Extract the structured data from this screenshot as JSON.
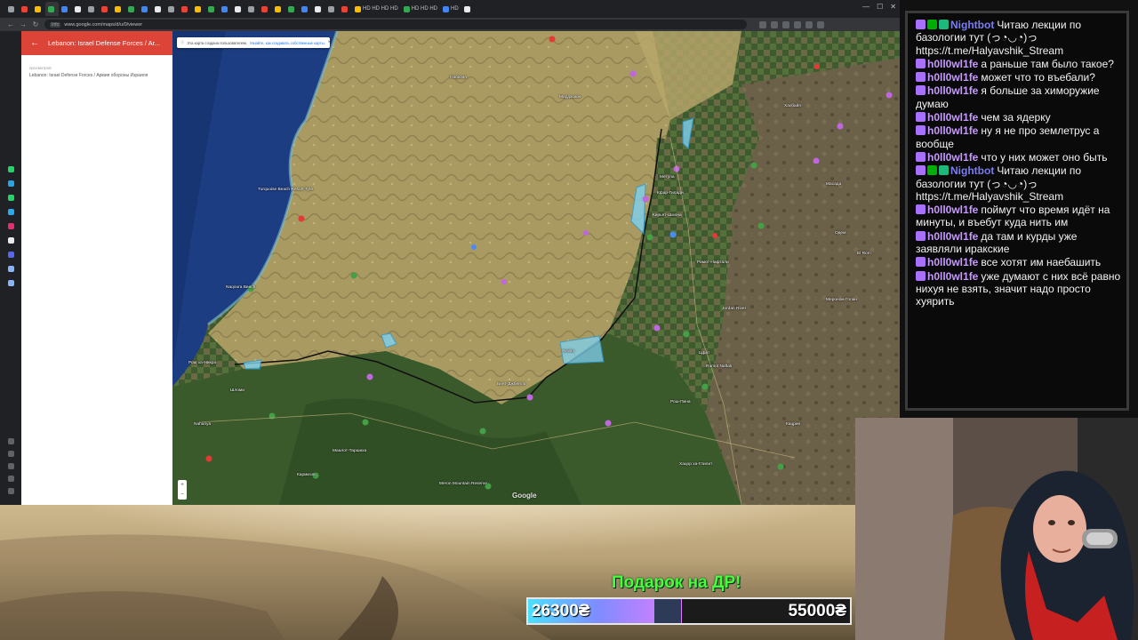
{
  "browser": {
    "tabs": [
      "",
      "",
      "",
      "",
      "",
      "",
      "",
      "",
      "",
      "",
      "",
      "",
      "",
      "",
      "",
      "",
      "",
      "",
      "",
      "",
      "",
      "",
      "",
      "",
      "",
      "",
      "HD HD HD HD",
      "HD HD HD",
      "HD",
      ""
    ],
    "url": "www.google.com/maps/d/u/0/viewer",
    "secure_label": "Info"
  },
  "maps_panel": {
    "title": "Lebanon: Israel Defense Forces / Ar...",
    "meta_label": "просмотров",
    "layer_name": "Lebanon: Israel Defense Forces / Армия обороны Израиля"
  },
  "map": {
    "banner_text": "Эта карта создана пользователем.",
    "banner_link": "Узнайте, как создавать собственные карты.",
    "places": {
      "turquoise": "Turquoise Beach Resort Tyre",
      "naqoura": "Naqoura Beach",
      "rosh": "Рош ха-Никра",
      "nahariya": "Nahariya",
      "karmiel": "Кармиэль",
      "meron": "Meron Mountain Reserve",
      "kiryat": "Кирьят-Шмона",
      "hulata": "Jordan River",
      "safed": "Цфат",
      "tiberias_hint": "Ramot Naftali",
      "golan": "Мероном Голан",
      "ramot": "Рамот-Нафтали",
      "avivim": "Avivim",
      "kfar_giladi": "Кфар-Гилади",
      "hasbaya": "Хасбайя",
      "marjayoun": "Марджаюн",
      "nabatieh": "Набатия",
      "bint_jbeil": "Бинт-Джбейль",
      "rosh_pina": "Рош-Пина",
      "hazor": "Хацор ха-Глилит",
      "maalot": "Маалот-Таршиха",
      "shlomi": "Шломи",
      "metula": "Метула",
      "el_rom": "El Rom",
      "masada": "Масада",
      "odem": "Одем",
      "katzrin": "Кацрин"
    },
    "google_logo": "Google",
    "zoom_in": "+",
    "zoom_out": "−"
  },
  "chat": {
    "messages": [
      {
        "user": "Nightbot",
        "type": "nightbot",
        "text": "Читаю лекции по базологии тут (っ◔◡◔)っ https://t.me/Halyavshik_Stream"
      },
      {
        "user": "h0ll0wl1fe",
        "type": "h0",
        "text": "а раньше там было такое?"
      },
      {
        "user": "h0ll0wl1fe",
        "type": "h0",
        "text": "может что то въебали?"
      },
      {
        "user": "h0ll0wl1fe",
        "type": "h0",
        "text": "я больше за химоружие думаю"
      },
      {
        "user": "h0ll0wl1fe",
        "type": "h0",
        "text": "чем за ядерку"
      },
      {
        "user": "h0ll0wl1fe",
        "type": "h0",
        "text": "ну я не про землетрус а вообще"
      },
      {
        "user": "h0ll0wl1fe",
        "type": "h0",
        "text": "что у них может оно быть"
      },
      {
        "user": "Nightbot",
        "type": "nightbot",
        "text": "Читаю лекции по базологии тут (っ◔◡◔)っ https://t.me/Halyavshik_Stream"
      },
      {
        "user": "h0ll0wl1fe",
        "type": "h0",
        "text": "поймут что время идёт на минуты, и въебут куда нить им"
      },
      {
        "user": "h0ll0wl1fe",
        "type": "h0",
        "text": "да там и курды уже заявляли иракские"
      },
      {
        "user": "h0ll0wl1fe",
        "type": "h0",
        "text": "все хотят им наебашить"
      },
      {
        "user": "h0ll0wl1fe",
        "type": "h0",
        "text": "уже думают с них всё равно нихуя не взять, значит надо просто хуярить"
      }
    ]
  },
  "donation": {
    "title": "Подарок на ДР!",
    "current": "26300₴",
    "goal": "55000₴",
    "progress": 0.478
  },
  "colors": {
    "maps_red": "#db4437",
    "nightbot": "#7c7cf0",
    "user": "#c79aff",
    "donation_title": "#44ff3a"
  }
}
